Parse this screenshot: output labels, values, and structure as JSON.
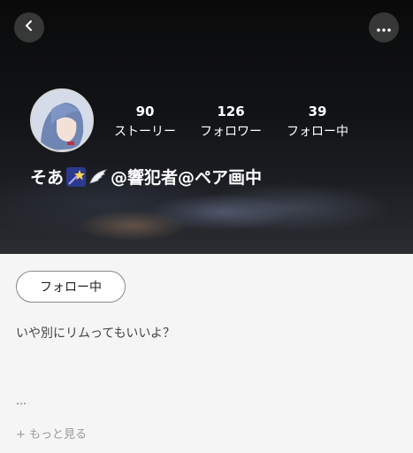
{
  "profile": {
    "name_prefix": "そあ",
    "name_suffix": "@響犯者@ペア画中",
    "emoji_icons": [
      "shooting-star-icon",
      "wing-icon"
    ],
    "stats": [
      {
        "value": "90",
        "label": "ストーリー"
      },
      {
        "value": "126",
        "label": "フォロワー"
      },
      {
        "value": "39",
        "label": "フォロー中"
      }
    ],
    "follow_label": "フォロー中",
    "bio": "いや別にリムってもいいよ？",
    "ellipsis": "…",
    "see_more": "+ もっと見る"
  },
  "colors": {
    "hero_background": "#111316",
    "page_background": "#f5f5f5",
    "text_light": "#ffffff"
  }
}
